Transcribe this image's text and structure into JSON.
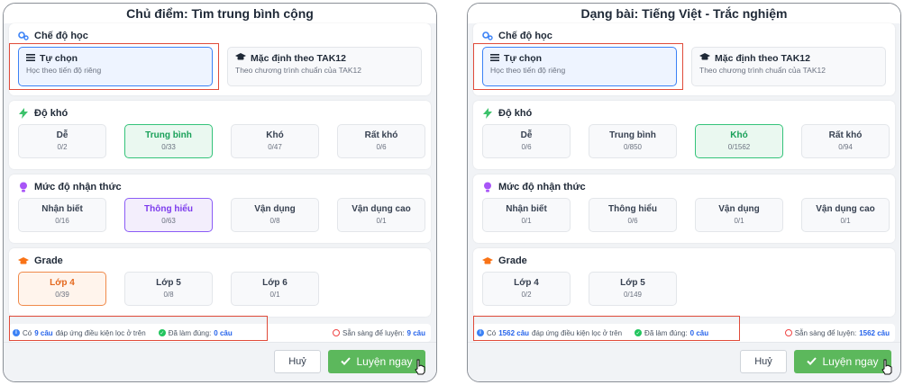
{
  "left": {
    "title": "Chủ điểm: Tìm trung bình cộng",
    "mode": {
      "heading": "Chế độ học",
      "options": [
        {
          "title": "Tự chọn",
          "subtitle": "Học theo tiến độ riêng"
        },
        {
          "title": "Mặc định theo TAK12",
          "subtitle": "Theo chương trình chuẩn của TAK12"
        }
      ]
    },
    "difficulty": {
      "heading": "Độ khó",
      "options": [
        {
          "name": "Dễ",
          "count": "0/2"
        },
        {
          "name": "Trung bình",
          "count": "0/33"
        },
        {
          "name": "Khó",
          "count": "0/47"
        },
        {
          "name": "Rất khó",
          "count": "0/6"
        }
      ]
    },
    "cognition": {
      "heading": "Mức độ nhận thức",
      "options": [
        {
          "name": "Nhận biết",
          "count": "0/16"
        },
        {
          "name": "Thông hiểu",
          "count": "0/63"
        },
        {
          "name": "Vận dụng",
          "count": "0/8"
        },
        {
          "name": "Vận dụng cao",
          "count": "0/1"
        }
      ]
    },
    "grade": {
      "heading": "Grade",
      "options": [
        {
          "name": "Lớp 4",
          "count": "0/39"
        },
        {
          "name": "Lớp 5",
          "count": "0/8"
        },
        {
          "name": "Lớp 6",
          "count": "0/1"
        }
      ]
    },
    "filter": {
      "prefix": "Có",
      "count": "9 câu",
      "suffix": "đáp ứng điều kiện lọc ở trên",
      "done_label": "Đã làm đúng:",
      "done_count": "0 câu",
      "ready_label": "Sẵn sàng để luyện:",
      "ready_count": "9 câu"
    },
    "cancel": "Huỷ",
    "go": "Luyện ngay"
  },
  "right": {
    "title": "Dạng bài: Tiếng Việt - Trắc nghiệm",
    "mode": {
      "heading": "Chế độ học",
      "options": [
        {
          "title": "Tự chọn",
          "subtitle": "Học theo tiến độ riêng"
        },
        {
          "title": "Mặc định theo TAK12",
          "subtitle": "Theo chương trình chuẩn của TAK12"
        }
      ]
    },
    "difficulty": {
      "heading": "Độ khó",
      "options": [
        {
          "name": "Dễ",
          "count": "0/6"
        },
        {
          "name": "Trung bình",
          "count": "0/850"
        },
        {
          "name": "Khó",
          "count": "0/1562"
        },
        {
          "name": "Rất khó",
          "count": "0/94"
        }
      ]
    },
    "cognition": {
      "heading": "Mức độ nhận thức",
      "options": [
        {
          "name": "Nhận biết",
          "count": "0/1"
        },
        {
          "name": "Thông hiểu",
          "count": "0/6"
        },
        {
          "name": "Vận dụng",
          "count": "0/1"
        },
        {
          "name": "Vận dụng cao",
          "count": "0/1"
        }
      ]
    },
    "grade": {
      "heading": "Grade",
      "options": [
        {
          "name": "Lớp 4",
          "count": "0/2"
        },
        {
          "name": "Lớp 5",
          "count": "0/149"
        }
      ]
    },
    "filter": {
      "prefix": "Có",
      "count": "1562 câu",
      "suffix": "đáp ứng điều kiện lọc ở trên",
      "done_label": "Đã làm đúng:",
      "done_count": "0 câu",
      "ready_label": "Sẵn sàng để luyện:",
      "ready_count": "1562 câu"
    },
    "cancel": "Huỷ",
    "go": "Luyện ngay"
  },
  "colors": {
    "accent_blue": "#3b82f6",
    "selected_green": "#34c37a",
    "selected_purple": "#8b5cf6",
    "selected_orange": "#f08a4b",
    "primary_button": "#5cb85c",
    "highlight_box": "#e04b3a"
  }
}
